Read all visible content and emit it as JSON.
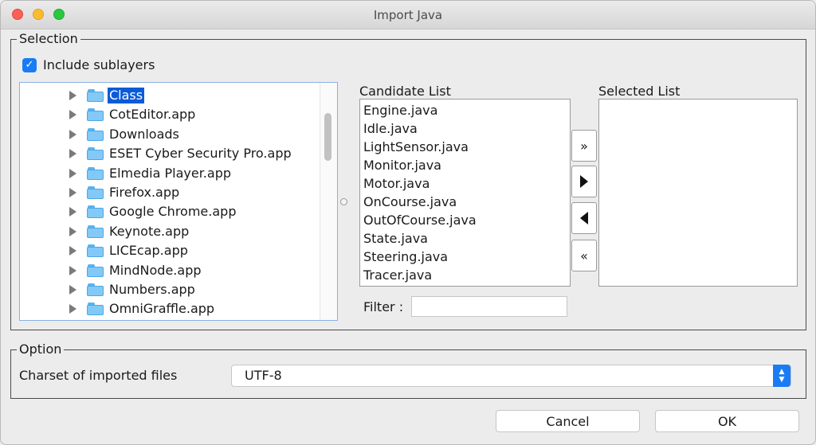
{
  "window": {
    "title": "Import Java"
  },
  "selection": {
    "label": "Selection",
    "include_sublayers": {
      "label": "Include sublayers",
      "checked": true
    },
    "tree_items": [
      {
        "label": "Class",
        "selected": true
      },
      {
        "label": "CotEditor.app"
      },
      {
        "label": "Downloads"
      },
      {
        "label": "ESET Cyber Security Pro.app"
      },
      {
        "label": "Elmedia Player.app"
      },
      {
        "label": "Firefox.app"
      },
      {
        "label": "Google Chrome.app"
      },
      {
        "label": "Keynote.app"
      },
      {
        "label": "LICEcap.app"
      },
      {
        "label": "MindNode.app"
      },
      {
        "label": "Numbers.app"
      },
      {
        "label": "OmniGraffle.app"
      }
    ],
    "candidate_list": {
      "title": "Candidate List",
      "items": [
        "Engine.java",
        "Idle.java",
        "LightSensor.java",
        "Monitor.java",
        "Motor.java",
        "OnCourse.java",
        "OutOfCourse.java",
        "State.java",
        "Steering.java",
        "Tracer.java"
      ]
    },
    "selected_list": {
      "title": "Selected List",
      "items": []
    },
    "move_buttons": {
      "add_all": "»",
      "remove_all": "«"
    },
    "filter": {
      "label": "Filter :",
      "value": ""
    }
  },
  "option": {
    "label": "Option",
    "charset_label": "Charset of imported files",
    "charset_value": "UTF-8",
    "stepper_icons": {
      "up": "▲",
      "down": "▼"
    }
  },
  "buttons": {
    "cancel": "Cancel",
    "ok": "OK"
  },
  "colors": {
    "accent": "#1a7cf4",
    "selection": "#0b5bd7"
  }
}
